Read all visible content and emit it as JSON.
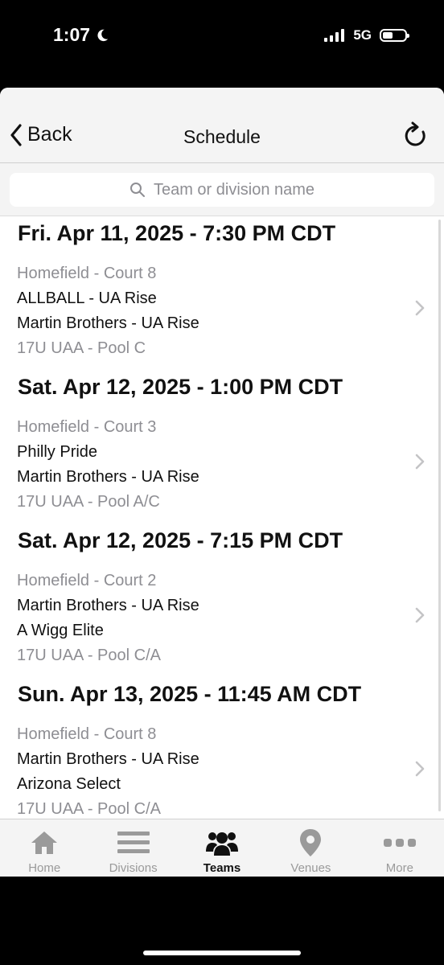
{
  "status": {
    "time": "1:07",
    "network": "5G"
  },
  "nav": {
    "back_label": "Back",
    "title": "Schedule"
  },
  "search": {
    "placeholder": "Team or division name"
  },
  "games": [
    {
      "date": "Fri. Apr 11, 2025 - 7:30 PM CDT",
      "location": "Homefield - Court 8",
      "team1": "ALLBALL - UA Rise",
      "team2": "Martin Brothers - UA Rise",
      "division": "17U UAA - Pool C"
    },
    {
      "date": "Sat. Apr 12, 2025 - 1:00 PM CDT",
      "location": "Homefield - Court 3",
      "team1": "Philly Pride",
      "team2": "Martin Brothers - UA Rise",
      "division": "17U UAA - Pool A/C"
    },
    {
      "date": "Sat. Apr 12, 2025 - 7:15 PM CDT",
      "location": "Homefield - Court 2",
      "team1": "Martin Brothers - UA Rise",
      "team2": "A Wigg Elite",
      "division": "17U UAA - Pool C/A"
    },
    {
      "date": "Sun. Apr 13, 2025 - 11:45 AM CDT",
      "location": "Homefield - Court 8",
      "team1": "Martin Brothers - UA Rise",
      "team2": "Arizona Select",
      "division": "17U UAA - Pool C/A"
    }
  ],
  "tabs": [
    {
      "label": "Home",
      "icon": "home-icon"
    },
    {
      "label": "Divisions",
      "icon": "list-icon"
    },
    {
      "label": "Teams",
      "icon": "users-icon",
      "active": true
    },
    {
      "label": "Venues",
      "icon": "map-pin-icon"
    },
    {
      "label": "More",
      "icon": "more-icon"
    }
  ],
  "colors": {
    "accent": "#111111",
    "inactive": "#9a9a9a",
    "secondary_text": "#8e8e93"
  }
}
